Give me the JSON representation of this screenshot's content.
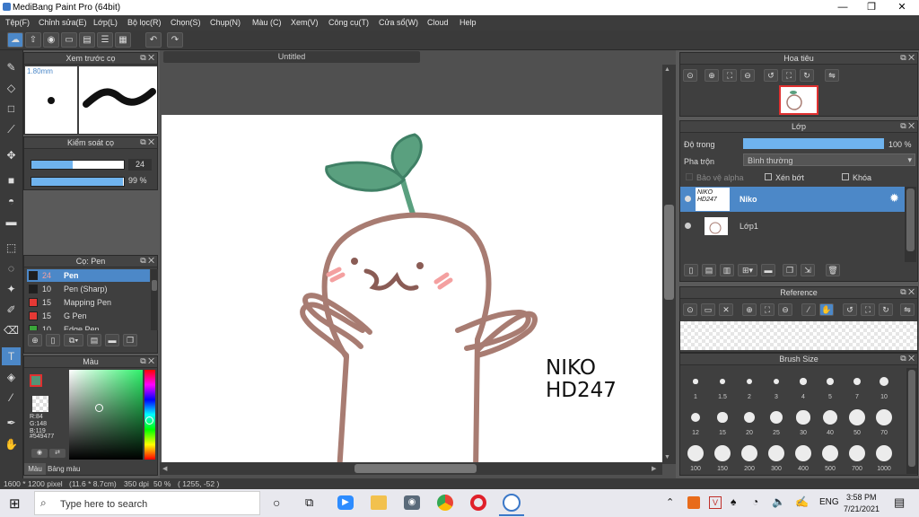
{
  "window": {
    "title": "MediBang Paint Pro (64bit)",
    "minimize": "—",
    "maximize": "❐",
    "close": "✕"
  },
  "menu": [
    "Tệp(F)",
    "Chỉnh sửa(E)",
    "Lớp(L)",
    "Bộ lọc(R)",
    "Chọn(S)",
    "Chụp(N)",
    "Màu (C)",
    "Xem(V)",
    "Công cụ(T)",
    "Cửa sổ(W)",
    "Cloud",
    "Help"
  ],
  "document": {
    "tab": "Untitled"
  },
  "canvas_text": {
    "line1": "NIKO",
    "line2": "HD247"
  },
  "brush_preview": {
    "title": "Xem trước cọ",
    "size": "1.80mm"
  },
  "brush_control": {
    "title": "Kiểm soát cọ",
    "size_value": "24",
    "opacity_value": "99 %",
    "size_level": 0.45,
    "opacity_level": 0.99
  },
  "brush_list": {
    "title": "Cọ: Pen",
    "items": [
      {
        "size": "24",
        "name": "Pen",
        "color": "#1f1f1f",
        "selected": true
      },
      {
        "size": "10",
        "name": "Pen (Sharp)",
        "color": "#1f1f1f",
        "selected": false
      },
      {
        "size": "15",
        "name": "Mapping Pen",
        "color": "#e53935",
        "selected": false
      },
      {
        "size": "15",
        "name": "G Pen",
        "color": "#e53935",
        "selected": false
      },
      {
        "size": "10",
        "name": "Edge Pen",
        "color": "#3aa53a",
        "selected": false
      }
    ]
  },
  "color_panel": {
    "title": "Màu",
    "r": "R:84",
    "g": "G:148",
    "b": "B:119",
    "hex": "#549477",
    "fg": "#549477",
    "tab_color": "Màu",
    "tab_palette": "Bảng màu"
  },
  "navigator": {
    "title": "Hoa tiêu"
  },
  "layers": {
    "title": "Lớp",
    "opacity_label": "Độ trong",
    "opacity_value": "100 %",
    "opacity_level": 1.0,
    "blend_label": "Pha trộn",
    "blend_value": "Bình thường",
    "protect_alpha": "Bảo vệ alpha",
    "clipping": "Xén bớt",
    "lock": "Khóa",
    "items": [
      {
        "name": "Niko",
        "thumb": "NIKO HD247",
        "selected": true
      },
      {
        "name": "Lớp1",
        "thumb": "",
        "selected": false
      }
    ]
  },
  "reference": {
    "title": "Reference"
  },
  "brush_size": {
    "title": "Brush Size",
    "sizes": [
      "1",
      "1.5",
      "2",
      "3",
      "4",
      "5",
      "7",
      "10",
      "12",
      "15",
      "20",
      "25",
      "30",
      "40",
      "50",
      "70",
      "100",
      "150",
      "200",
      "300",
      "400",
      "500",
      "700",
      "1000"
    ]
  },
  "status": {
    "dimensions": "1600 * 1200 pixel",
    "physical": "(11.6 * 8.7cm)",
    "dpi": "350 dpi",
    "zoom": "50 %",
    "coords": "( 1255, -52 )"
  },
  "taskbar": {
    "search_placeholder": "Type here to search",
    "time": "3:58 PM",
    "date": "7/21/2021",
    "lang": "ENG"
  },
  "colors": {
    "accent": "#4c88c8",
    "sprout": "#5aa07f",
    "outline": "#a87c72",
    "blush": "#f4a0a0"
  }
}
